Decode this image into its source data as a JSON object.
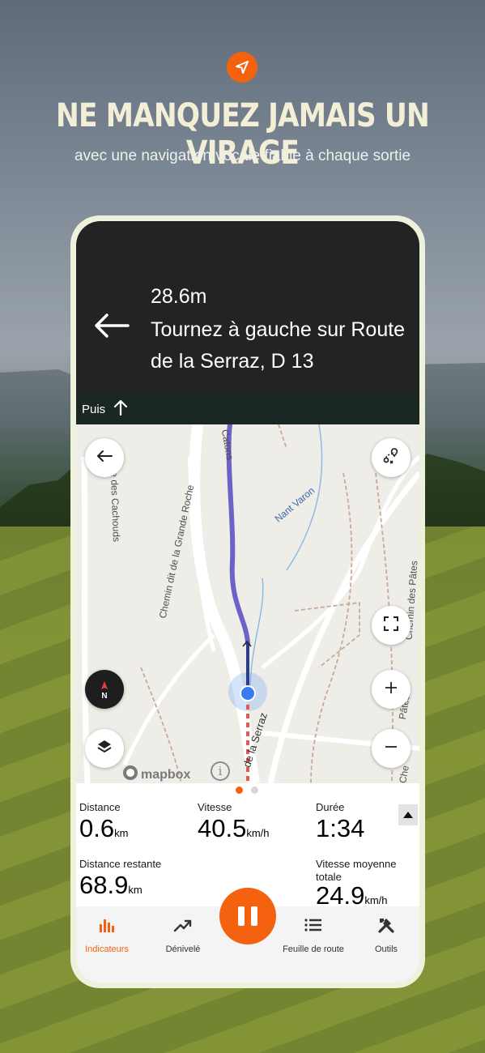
{
  "promo": {
    "icon": "navigation-arrow-icon",
    "headline": "NE MANQUEZ JAMAIS UN VIRAGE",
    "subline": "avec une navigation vocale fiable à chaque sortie"
  },
  "navigation": {
    "distance": "28.6m",
    "instruction": "Tournez à gauche sur Route de la Serraz, D 13",
    "then_label": "Puis",
    "colors": {
      "panel": "#222424",
      "then_bar": "#1b2722"
    }
  },
  "map": {
    "labels": [
      "Route des Cachouds",
      "Chemin dit de la Grande Roche",
      "Nant Varon",
      "Catons",
      "Chemin des Pâtes",
      "Pâtes",
      "de la Serraz",
      "Che"
    ],
    "attribution": "mapbox",
    "info_glyph": "i",
    "compass_label": "N",
    "route_color": "#6b63c8"
  },
  "stats": {
    "page_dots": 2,
    "active_dot": 0,
    "items": [
      {
        "label": "Distance",
        "value": "0.6",
        "unit": "km"
      },
      {
        "label": "Vitesse",
        "value": "40.5",
        "unit": "km/h"
      },
      {
        "label": "Durée",
        "value": "1:34",
        "unit": ""
      },
      {
        "label": "Distance restante",
        "value": "68.9",
        "unit": "km"
      },
      {
        "label": "Vitesse moyenne totale",
        "value": "24.9",
        "unit": "km/h"
      }
    ]
  },
  "tabs": [
    {
      "label": "Indicateurs",
      "icon": "bar-chart-icon",
      "active": true
    },
    {
      "label": "Dénivelé",
      "icon": "trend-up-icon",
      "active": false
    },
    {
      "label": "Feuille de route",
      "icon": "list-icon",
      "active": false
    },
    {
      "label": "Outils",
      "icon": "tools-icon",
      "active": false
    }
  ],
  "accent_color": "#f4620f"
}
